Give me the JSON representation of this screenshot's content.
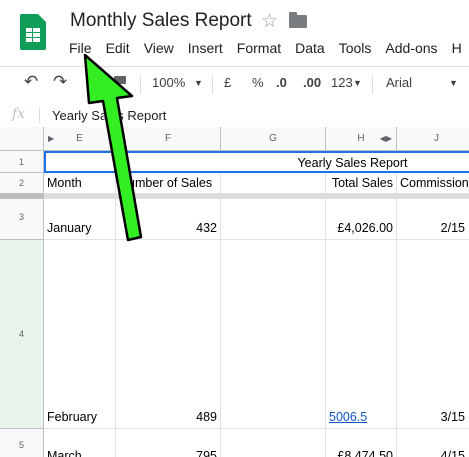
{
  "header": {
    "title": "Monthly Sales Report",
    "menu": [
      "File",
      "Edit",
      "View",
      "Insert",
      "Format",
      "Data",
      "Tools",
      "Add-ons",
      "H"
    ]
  },
  "toolbar": {
    "zoom": "100%",
    "currency": "£",
    "percent": "%",
    "decrease_decimals": ".0",
    "increase_decimals": ".00",
    "more_formats": "123",
    "font": "Arial"
  },
  "formula_bar": {
    "label": "fx",
    "value": "Yearly Sales Report"
  },
  "columns": [
    "E",
    "F",
    "G",
    "H",
    "J"
  ],
  "rows": {
    "r1": {
      "num": "1",
      "merged_title": "Yearly Sales Report"
    },
    "r2": {
      "num": "2",
      "month": "Month",
      "sales": "Number of Sales",
      "total": "Total Sales",
      "commission": "Commission"
    },
    "r3": {
      "num": "3",
      "month": "January",
      "sales": "432",
      "total": "£4,026.00",
      "commission": "2/15"
    },
    "r4": {
      "num": "4",
      "month": "February",
      "sales": "489",
      "total": "5006.5",
      "commission": "3/15"
    },
    "r5": {
      "num": "5",
      "month": "March",
      "sales": "795",
      "total": "£8,474.50",
      "commission": "4/15"
    }
  },
  "annotation": {
    "arrow_color": "#33ee22",
    "points_to": "File"
  }
}
